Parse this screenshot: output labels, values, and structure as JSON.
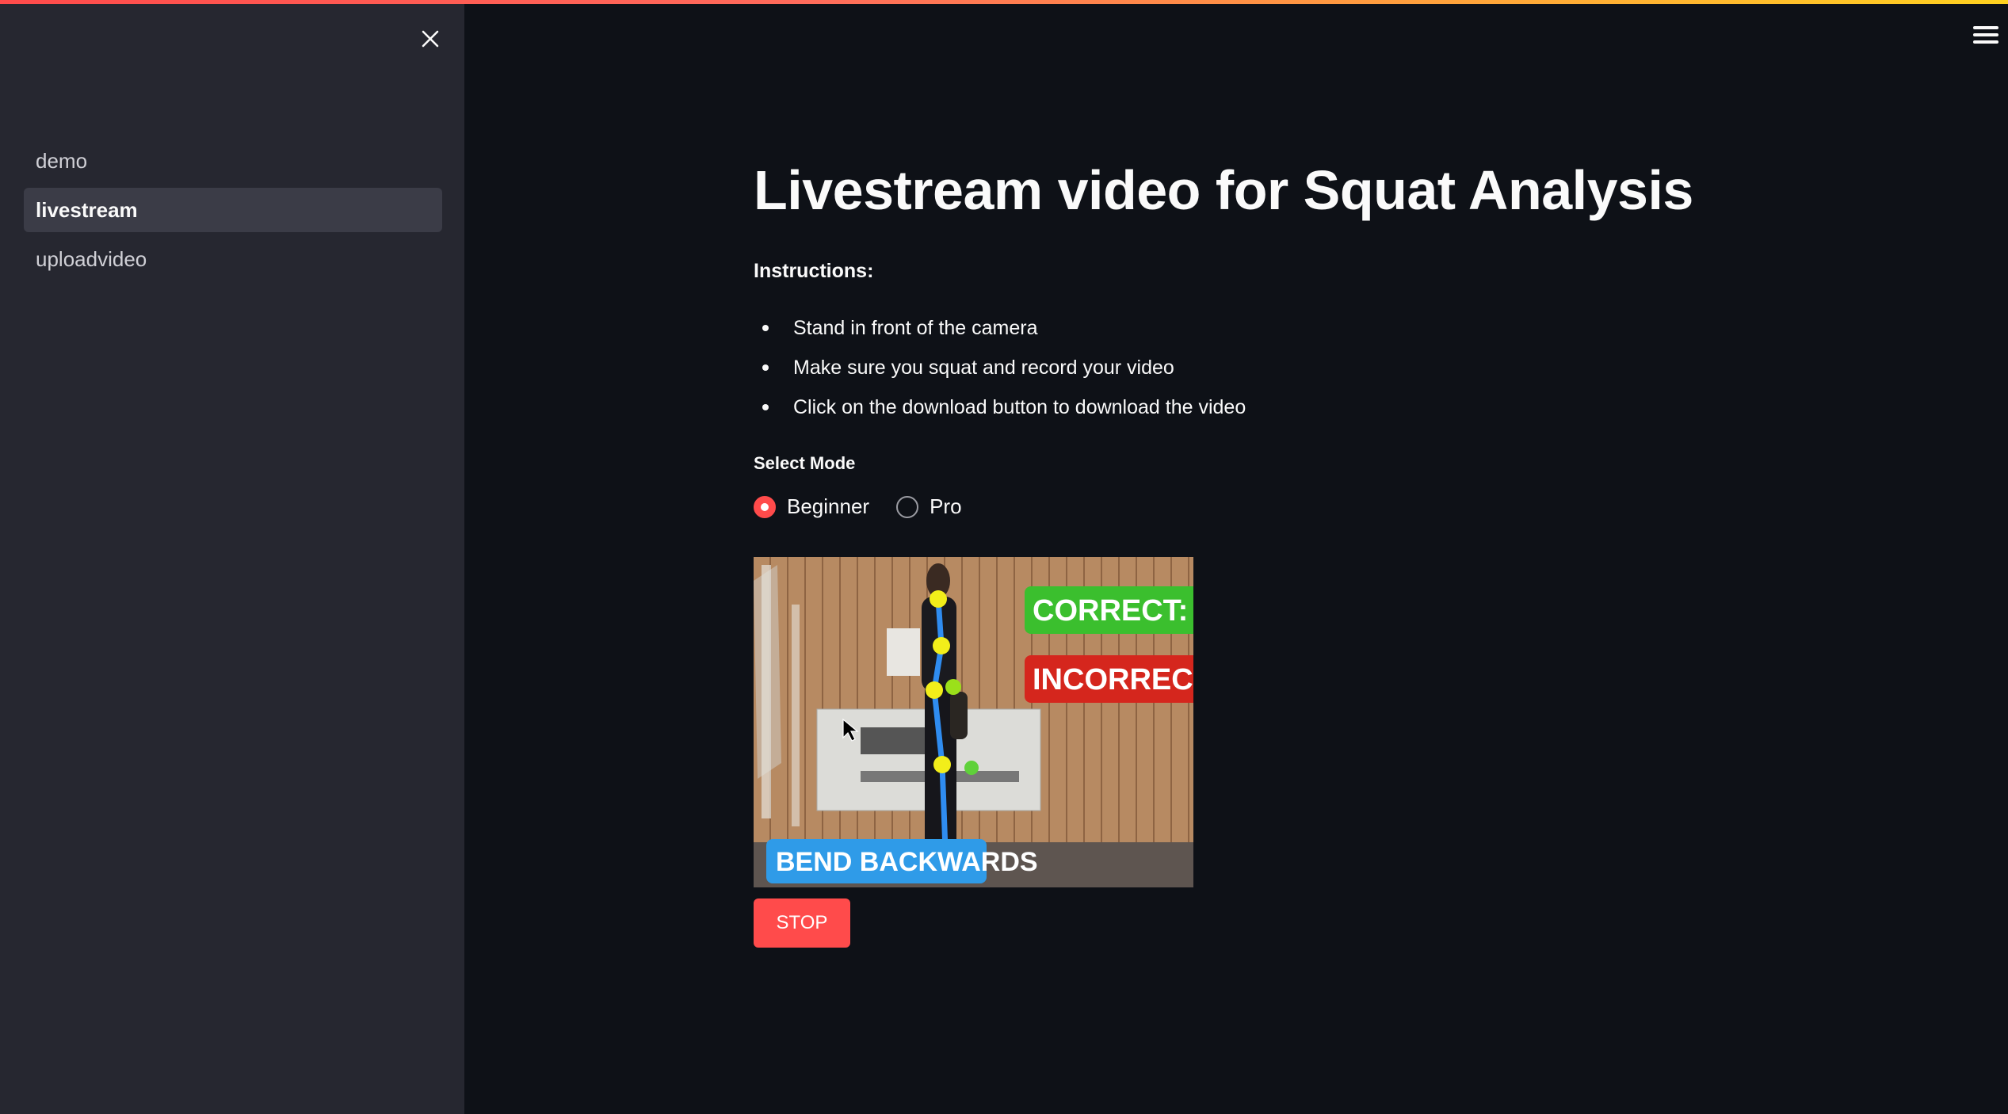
{
  "sidebar": {
    "close_icon": "close-icon",
    "items": [
      {
        "label": "demo",
        "active": false
      },
      {
        "label": "livestream",
        "active": true
      },
      {
        "label": "uploadvideo",
        "active": false
      }
    ]
  },
  "header": {
    "menu_icon": "hamburger-menu-icon"
  },
  "main": {
    "title": "Livestream video for Squat Analysis",
    "instructions_label": "Instructions:",
    "instructions": [
      "Stand in front of the camera",
      "Make sure you squat and record your video",
      "Click on the download button to download the video"
    ],
    "mode_label": "Select Mode",
    "modes": [
      {
        "label": "Beginner",
        "selected": true
      },
      {
        "label": "Pro",
        "selected": false
      }
    ],
    "video": {
      "correct_label": "CORRECT:",
      "incorrect_label": "INCORRECT",
      "feedback_label": "BEND  BACKWARDS"
    },
    "stop_label": "STOP"
  },
  "colors": {
    "accent": "#ff4b4b",
    "background": "#0e1117",
    "sidebar": "#262730",
    "correct_badge": "#3bbf2e",
    "incorrect_badge": "#d5261d",
    "feedback_badge": "#2f9be8"
  }
}
